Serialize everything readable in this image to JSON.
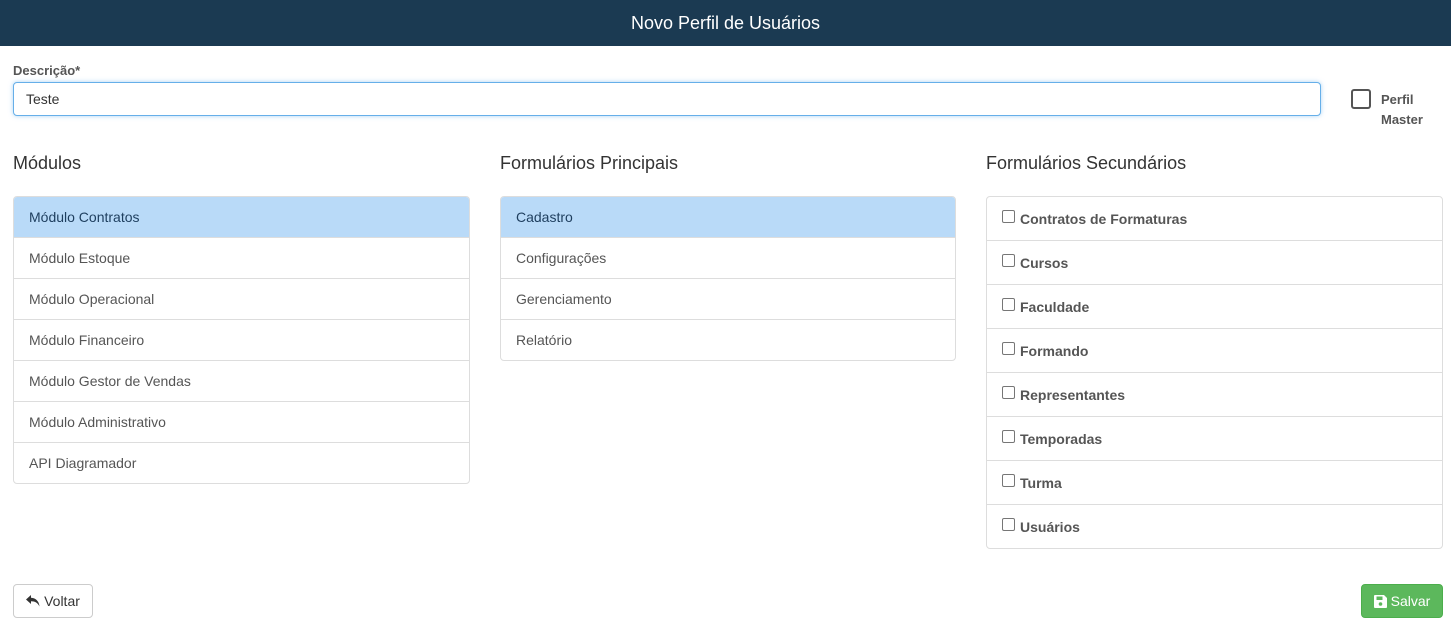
{
  "header": {
    "title": "Novo Perfil de Usuários"
  },
  "descricao": {
    "label": "Descrição*",
    "value": "Teste"
  },
  "perfil_master": {
    "label": "Perfil Master",
    "checked": false
  },
  "modulos": {
    "title": "Módulos",
    "items": [
      {
        "label": "Módulo Contratos",
        "active": true
      },
      {
        "label": "Módulo Estoque"
      },
      {
        "label": "Módulo Operacional"
      },
      {
        "label": "Módulo Financeiro"
      },
      {
        "label": "Módulo Gestor de Vendas"
      },
      {
        "label": "Módulo Administrativo"
      },
      {
        "label": "API Diagramador"
      }
    ]
  },
  "formularios_principais": {
    "title": "Formulários Principais",
    "items": [
      {
        "label": "Cadastro",
        "active": true
      },
      {
        "label": "Configurações"
      },
      {
        "label": "Gerenciamento"
      },
      {
        "label": "Relatório"
      }
    ]
  },
  "formularios_secundarios": {
    "title": "Formulários Secundários",
    "items": [
      {
        "label": "Contratos de Formaturas",
        "checked": false
      },
      {
        "label": "Cursos",
        "checked": false
      },
      {
        "label": "Faculdade",
        "checked": false
      },
      {
        "label": "Formando",
        "checked": false
      },
      {
        "label": "Representantes",
        "checked": false
      },
      {
        "label": "Temporadas",
        "checked": false
      },
      {
        "label": "Turma",
        "checked": false
      },
      {
        "label": "Usuários",
        "checked": false
      }
    ]
  },
  "buttons": {
    "voltar": {
      "label": "Voltar",
      "icon": "reply-icon"
    },
    "salvar": {
      "label": "Salvar",
      "icon": "floppy-disk-icon"
    }
  },
  "colors": {
    "header_bg": "#1b3a52",
    "active_item_bg": "#b9daf8",
    "save_button": "#5cb85c"
  }
}
